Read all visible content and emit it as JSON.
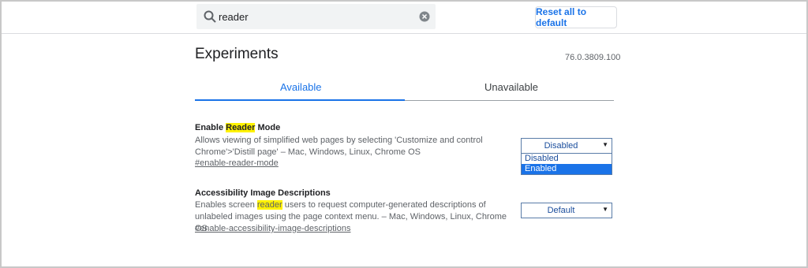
{
  "search": {
    "value": "reader"
  },
  "header": {
    "reset_label": "Reset all to default"
  },
  "page": {
    "title": "Experiments",
    "version": "76.0.3809.100"
  },
  "tabs": [
    {
      "label": "Available",
      "active": true
    },
    {
      "label": "Unavailable",
      "active": false
    }
  ],
  "experiments": [
    {
      "name_pre": "Enable ",
      "name_hl": "Reader",
      "name_post": " Mode",
      "desc_pre": "Allows viewing of simplified web pages by selecting 'Customize and control Chrome'>'Distill page' – Mac, Windows, Linux, Chrome OS",
      "link": "#enable-reader-mode",
      "select_value": "Disabled",
      "options": [
        "Disabled",
        "Enabled"
      ],
      "highlighted_option": "Enabled"
    },
    {
      "name": "Accessibility Image Descriptions",
      "desc_pre": "Enables screen ",
      "desc_hl": "reader",
      "desc_post": " users to request computer-generated descriptions of unlabeled images using the page context menu. – Mac, Windows, Linux, Chrome OS",
      "link": "#enable-accessibility-image-descriptions",
      "select_value": "Default"
    }
  ],
  "colors": {
    "accent": "#1a73e8",
    "highlight": "#fff200"
  },
  "icons": {
    "search": "search-icon",
    "clear": "clear-icon",
    "dropdown": "chevron-down-icon"
  }
}
